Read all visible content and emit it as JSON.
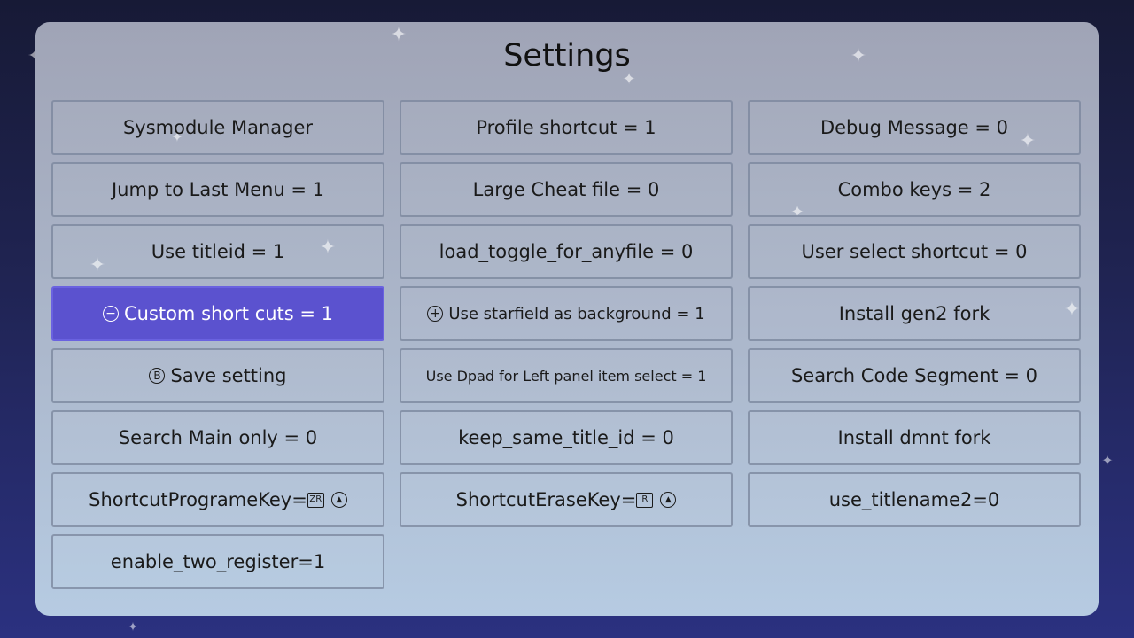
{
  "title": "Settings",
  "colors": {
    "selected_bg": "#5b52cf",
    "panel_top": "#a0a4b6",
    "panel_bottom": "#b6cbe2",
    "background": "#1f2350"
  },
  "icons": {
    "minus_circle": "⊖",
    "plus_circle": "⊕",
    "b_button": "B",
    "zr_button": "ZR",
    "r_button": "R",
    "up_triangle": "▲",
    "star": "✦"
  },
  "columns": [
    {
      "items": [
        {
          "label": "Sysmodule Manager"
        },
        {
          "label": "Jump to Last Menu = 1"
        },
        {
          "label": "Use titleid = 1"
        },
        {
          "label": "Custom short cuts = 1"
        },
        {
          "label": "Save setting"
        },
        {
          "label": "Search Main only = 0"
        },
        {
          "label": "ShortcutProgrameKey="
        },
        {
          "label": "enable_two_register=1"
        }
      ]
    },
    {
      "items": [
        {
          "label": "Profile shortcut = 1"
        },
        {
          "label": "Large Cheat file = 0"
        },
        {
          "label": "load_toggle_for_anyfile = 0"
        },
        {
          "label": "Use starfield as background = 1"
        },
        {
          "label": "Use Dpad for Left panel item select = 1"
        },
        {
          "label": "keep_same_title_id = 0"
        },
        {
          "label": "ShortcutEraseKey="
        }
      ]
    },
    {
      "items": [
        {
          "label": "Debug Message = 0"
        },
        {
          "label": "Combo keys = 2"
        },
        {
          "label": "User select shortcut = 0"
        },
        {
          "label": "Install gen2 fork"
        },
        {
          "label": "Search Code Segment = 0"
        },
        {
          "label": "Install dmnt fork"
        },
        {
          "label": "use_titlename2=0"
        }
      ]
    }
  ]
}
